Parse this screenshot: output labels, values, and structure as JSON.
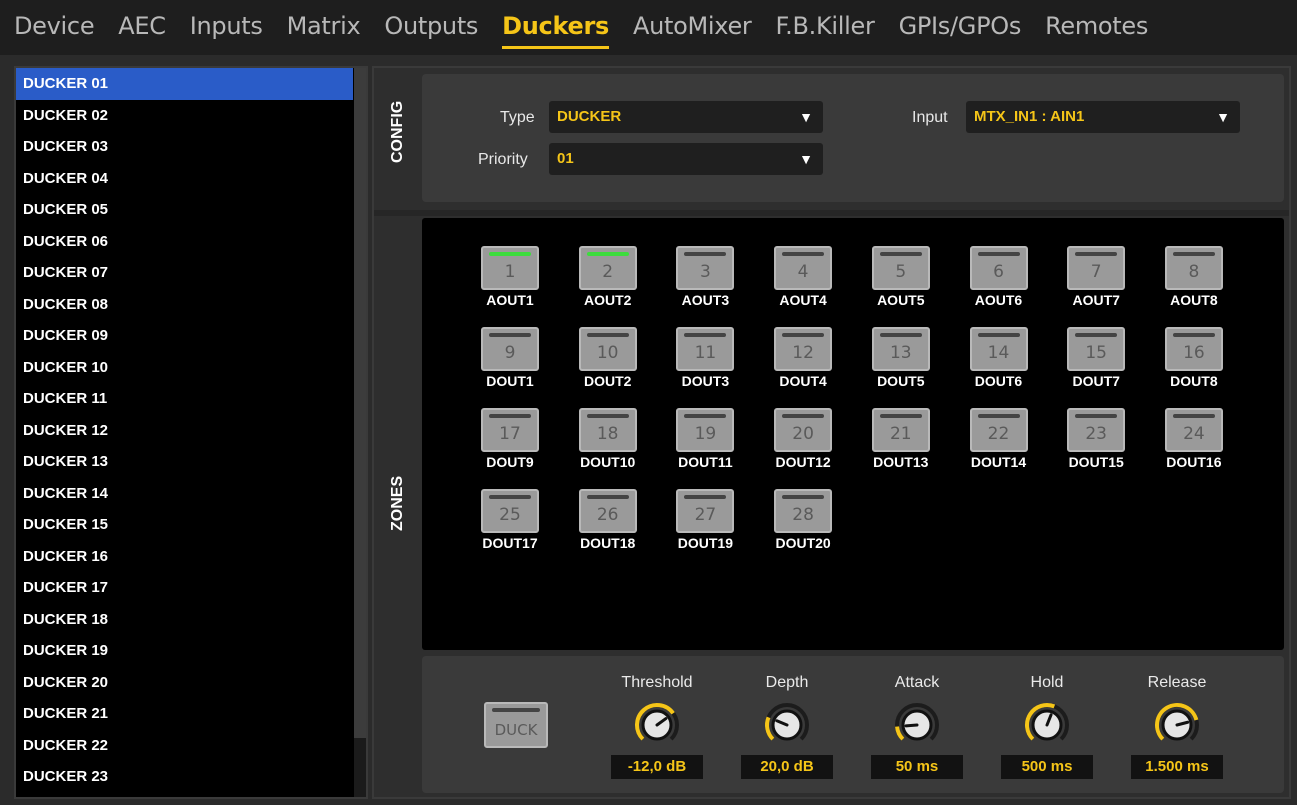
{
  "tabs": [
    {
      "label": "Device",
      "active": false
    },
    {
      "label": "AEC",
      "active": false
    },
    {
      "label": "Inputs",
      "active": false
    },
    {
      "label": "Matrix",
      "active": false
    },
    {
      "label": "Outputs",
      "active": false
    },
    {
      "label": "Duckers",
      "active": true
    },
    {
      "label": "AutoMixer",
      "active": false
    },
    {
      "label": "F.B.Killer",
      "active": false
    },
    {
      "label": "GPIs/GPOs",
      "active": false
    },
    {
      "label": "Remotes",
      "active": false
    }
  ],
  "ducker_list": [
    "DUCKER 01",
    "DUCKER 02",
    "DUCKER 03",
    "DUCKER 04",
    "DUCKER 05",
    "DUCKER 06",
    "DUCKER 07",
    "DUCKER 08",
    "DUCKER 09",
    "DUCKER 10",
    "DUCKER 11",
    "DUCKER 12",
    "DUCKER 13",
    "DUCKER 14",
    "DUCKER 15",
    "DUCKER 16",
    "DUCKER 17",
    "DUCKER 18",
    "DUCKER 19",
    "DUCKER 20",
    "DUCKER 21",
    "DUCKER 22",
    "DUCKER 23"
  ],
  "selected_ducker": "DUCKER 01",
  "config": {
    "section_label": "CONFIG",
    "type_label": "Type",
    "type_value": "DUCKER",
    "priority_label": "Priority",
    "priority_value": "01",
    "input_label": "Input",
    "input_value": "MTX_IN1 : AIN1"
  },
  "zones": {
    "section_label": "ZONES",
    "items": [
      {
        "num": "1",
        "label": "AOUT1",
        "on": true
      },
      {
        "num": "2",
        "label": "AOUT2",
        "on": true
      },
      {
        "num": "3",
        "label": "AOUT3",
        "on": false
      },
      {
        "num": "4",
        "label": "AOUT4",
        "on": false
      },
      {
        "num": "5",
        "label": "AOUT5",
        "on": false
      },
      {
        "num": "6",
        "label": "AOUT6",
        "on": false
      },
      {
        "num": "7",
        "label": "AOUT7",
        "on": false
      },
      {
        "num": "8",
        "label": "AOUT8",
        "on": false
      },
      {
        "num": "9",
        "label": "DOUT1",
        "on": false
      },
      {
        "num": "10",
        "label": "DOUT2",
        "on": false
      },
      {
        "num": "11",
        "label": "DOUT3",
        "on": false
      },
      {
        "num": "12",
        "label": "DOUT4",
        "on": false
      },
      {
        "num": "13",
        "label": "DOUT5",
        "on": false
      },
      {
        "num": "14",
        "label": "DOUT6",
        "on": false
      },
      {
        "num": "15",
        "label": "DOUT7",
        "on": false
      },
      {
        "num": "16",
        "label": "DOUT8",
        "on": false
      },
      {
        "num": "17",
        "label": "DOUT9",
        "on": false
      },
      {
        "num": "18",
        "label": "DOUT10",
        "on": false
      },
      {
        "num": "19",
        "label": "DOUT11",
        "on": false
      },
      {
        "num": "20",
        "label": "DOUT12",
        "on": false
      },
      {
        "num": "21",
        "label": "DOUT13",
        "on": false
      },
      {
        "num": "22",
        "label": "DOUT14",
        "on": false
      },
      {
        "num": "23",
        "label": "DOUT15",
        "on": false
      },
      {
        "num": "24",
        "label": "DOUT16",
        "on": false
      },
      {
        "num": "25",
        "label": "DOUT17",
        "on": false
      },
      {
        "num": "26",
        "label": "DOUT18",
        "on": false
      },
      {
        "num": "27",
        "label": "DOUT19",
        "on": false
      },
      {
        "num": "28",
        "label": "DOUT20",
        "on": false
      }
    ]
  },
  "controls": {
    "duck_button_label": "DUCK",
    "knobs": [
      {
        "title": "Threshold",
        "value": "-12,0 dB",
        "position": 0.7
      },
      {
        "title": "Depth",
        "value": "20,0 dB",
        "position": 0.25
      },
      {
        "title": "Attack",
        "value": "50 ms",
        "position": 0.15
      },
      {
        "title": "Hold",
        "value": "500 ms",
        "position": 0.58
      },
      {
        "title": "Release",
        "value": "1.500 ms",
        "position": 0.78
      }
    ]
  },
  "colors": {
    "accent": "#f5c518",
    "selection": "#2a5cc8",
    "zone_on": "#3ddc3d"
  }
}
